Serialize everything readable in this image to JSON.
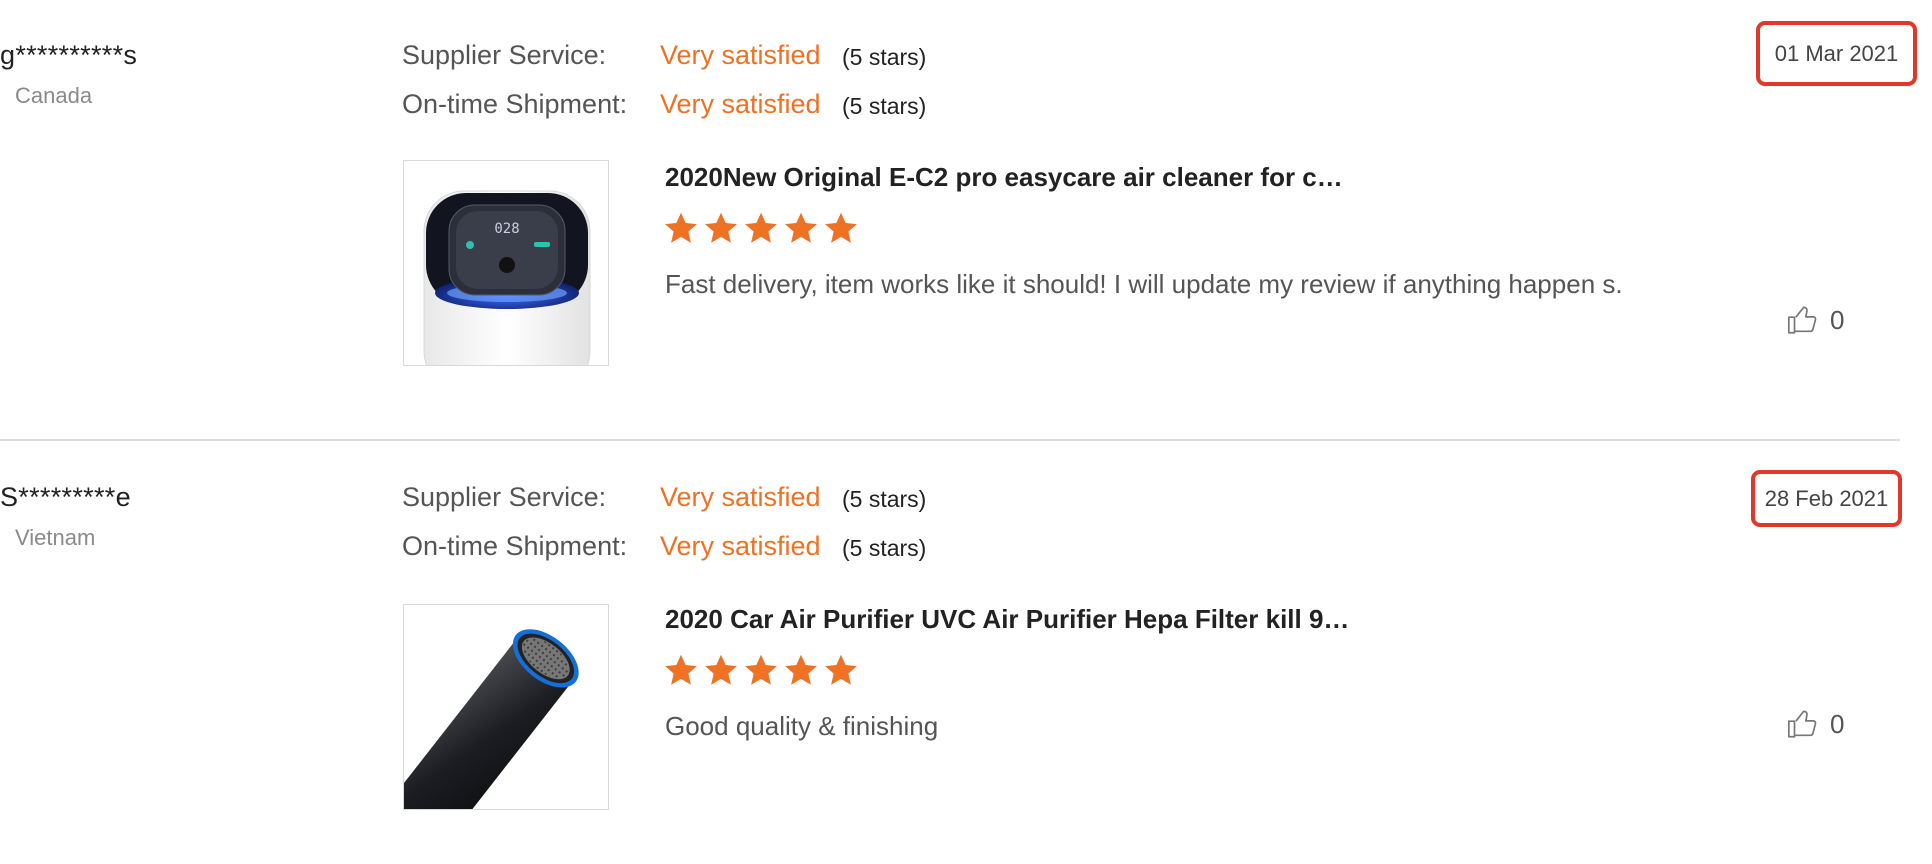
{
  "reviews": [
    {
      "buyer": "g**********s",
      "country": "Canada",
      "supplier_service_label": "Supplier Service:",
      "supplier_service_value": "Very satisfied",
      "supplier_service_stars": "(5 stars)",
      "shipment_label": "On-time Shipment:",
      "shipment_value": "Very satisfied",
      "shipment_stars": "(5 stars)",
      "product_title": "2020New Original E-C2 pro easycare air cleaner for c…",
      "rating": 5,
      "comment": "Fast delivery, item works like it should! I will update my review if anything happen s.",
      "date": "01 Mar 2021",
      "likes": "0",
      "image_icon": "air-purifier-icon"
    },
    {
      "buyer": "S*********e",
      "country": "Vietnam",
      "supplier_service_label": "Supplier Service:",
      "supplier_service_value": "Very satisfied",
      "supplier_service_stars": "(5 stars)",
      "shipment_label": "On-time Shipment:",
      "shipment_value": "Very satisfied",
      "shipment_stars": "(5 stars)",
      "product_title": "2020 Car Air Purifier UVC Air Purifier Hepa Filter kill 9…",
      "rating": 5,
      "comment": "Good quality & finishing",
      "date": "28 Feb 2021",
      "likes": "0",
      "image_icon": "car-air-purifier-icon"
    }
  ],
  "colors": {
    "accent": "#ee7124",
    "highlight_border": "#e0392b",
    "divider": "#dcdcdc"
  }
}
